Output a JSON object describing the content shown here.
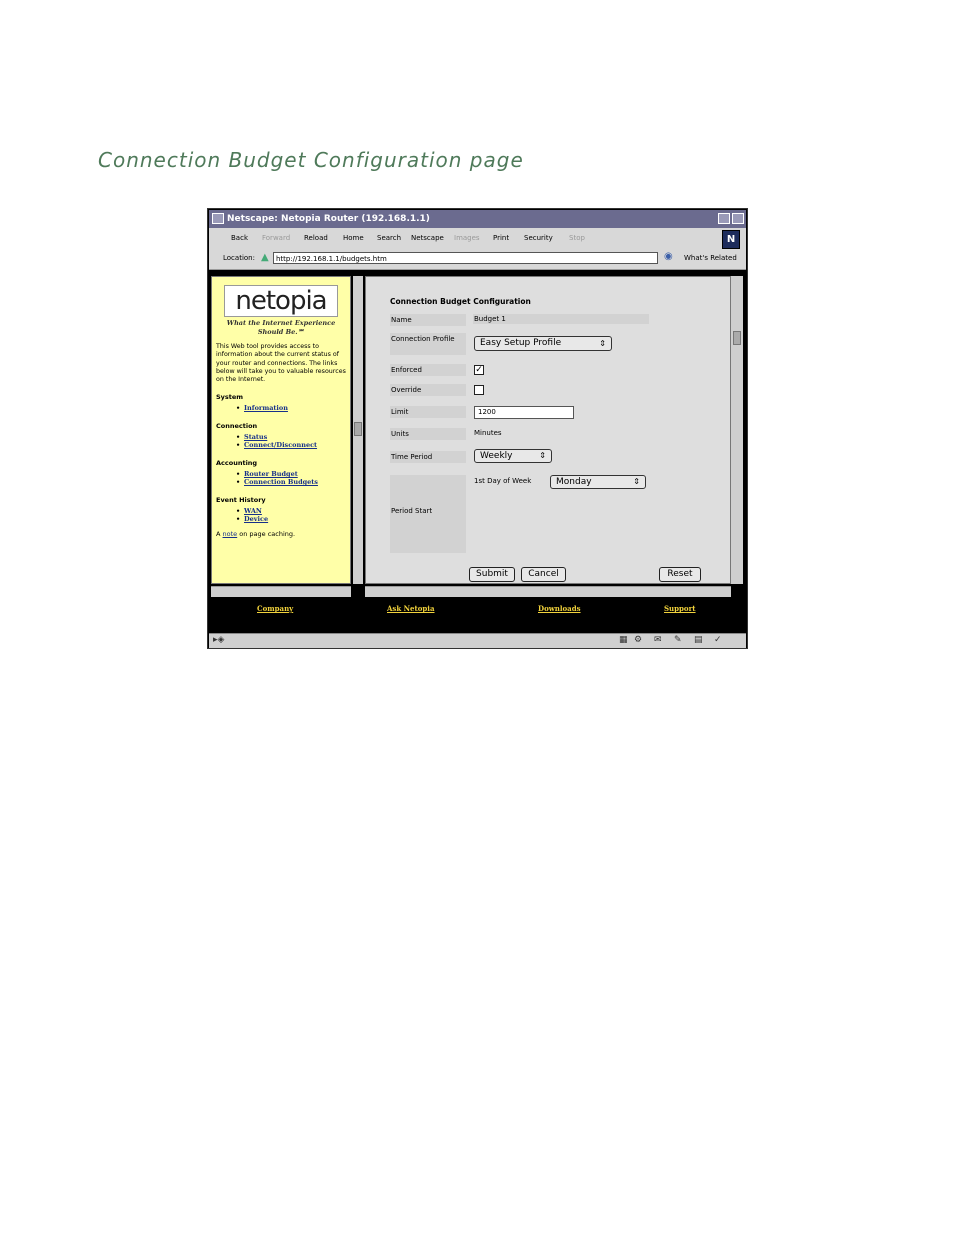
{
  "doc_title": "Connection Budget Configuration page",
  "window": {
    "title": "Netscape: Netopia Router (192.168.1.1)"
  },
  "toolbar": {
    "back": "Back",
    "forward": "Forward",
    "reload": "Reload",
    "home": "Home",
    "search": "Search",
    "netscape": "Netscape",
    "images": "Images",
    "print": "Print",
    "security": "Security",
    "stop": "Stop",
    "logo": "N"
  },
  "location": {
    "label": "Location:",
    "url": "http://192.168.1.1/budgets.htm",
    "related": "What's Related"
  },
  "sidebar": {
    "logo": "netopia",
    "tagline": "What the Internet Experience Should Be.℠",
    "intro": "This Web tool provides access to information about the current status of your router and connections. The links below will take you to valuable resources on the Internet.",
    "system": {
      "heading": "System",
      "links": [
        "Information"
      ]
    },
    "connection": {
      "heading": "Connection",
      "links": [
        "Status",
        "Connect/Disconnect"
      ]
    },
    "accounting": {
      "heading": "Accounting",
      "links": [
        "Router Budget",
        "Connection Budgets"
      ]
    },
    "events": {
      "heading": "Event History",
      "links": [
        "WAN",
        "Device"
      ]
    },
    "note": {
      "prefix": "A",
      "link": "note",
      "suffix": "on page caching."
    }
  },
  "form": {
    "title": "Connection Budget Configuration",
    "name_label": "Name",
    "name_value": "Budget 1",
    "profile_label": "Connection Profile",
    "profile_value": "Easy Setup Profile",
    "enforced_label": "Enforced",
    "enforced_checked": true,
    "override_label": "Override",
    "override_checked": false,
    "limit_label": "Limit",
    "limit_value": "1200",
    "units_label": "Units",
    "units_value": "Minutes",
    "period_label": "Time Period",
    "period_value": "Weekly",
    "start_label": "Period Start",
    "first_day_label": "1st Day of Week",
    "first_day_value": "Monday",
    "submit": "Submit",
    "cancel": "Cancel",
    "reset": "Reset"
  },
  "footer": {
    "company": "Company",
    "ask": "Ask Netopia",
    "downloads": "Downloads",
    "support": "Support"
  }
}
